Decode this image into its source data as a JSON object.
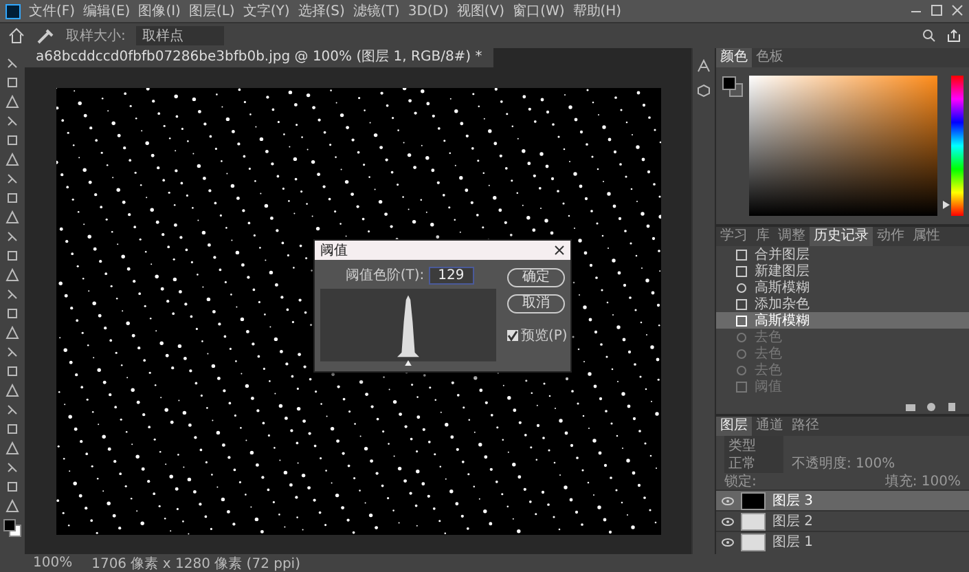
{
  "menu": [
    "文件(F)",
    "编辑(E)",
    "图像(I)",
    "图层(L)",
    "文字(Y)",
    "选择(S)",
    "滤镜(T)",
    "3D(D)",
    "视图(V)",
    "窗口(W)",
    "帮助(H)"
  ],
  "options_bar": {
    "sample_size_label": "取样大小:",
    "sample_size_value": "取样点"
  },
  "document_tab": {
    "title": "a68bcddccd0fbfb07286be3bfb0b.jpg @ 100% (图层 1, RGB/8#) *"
  },
  "threshold_dialog": {
    "title": "阈值",
    "level_label": "阈值色阶(T):",
    "level_value": "129",
    "ok": "确定",
    "cancel": "取消",
    "preview_label": "预览(P)",
    "preview_checked": true
  },
  "color_panel": {
    "hue_slider": {
      "level": 0.08
    },
    "tabs": [
      {
        "label": "颜色",
        "selected": true
      },
      {
        "label": "色板",
        "selected": false
      }
    ]
  },
  "history_panel": {
    "tabs": [
      {
        "label": "学习",
        "selected": false
      },
      {
        "label": "库",
        "selected": false
      },
      {
        "label": "调整",
        "selected": false
      },
      {
        "label": "历史记录",
        "selected": true
      },
      {
        "label": "动作",
        "selected": false
      },
      {
        "label": "属性",
        "selected": false
      }
    ],
    "items": [
      {
        "label": "合并图层",
        "kind": "doc",
        "selected": false,
        "disabled": false
      },
      {
        "label": "新建图层",
        "kind": "doc",
        "selected": false,
        "disabled": false
      },
      {
        "label": "高斯模糊",
        "kind": "filter",
        "selected": false,
        "disabled": false
      },
      {
        "label": "添加杂色",
        "kind": "doc",
        "selected": false,
        "disabled": false
      },
      {
        "label": "高斯模糊",
        "kind": "doc",
        "selected": true,
        "disabled": false
      },
      {
        "label": "去色",
        "kind": "filter",
        "selected": false,
        "disabled": true
      },
      {
        "label": "去色",
        "kind": "filter",
        "selected": false,
        "disabled": true
      },
      {
        "label": "去色",
        "kind": "filter",
        "selected": false,
        "disabled": true
      },
      {
        "label": "阈值",
        "kind": "doc",
        "selected": false,
        "disabled": true
      }
    ]
  },
  "layers_panel": {
    "tabs": [
      {
        "label": "图层",
        "selected": true
      },
      {
        "label": "通道",
        "selected": false
      },
      {
        "label": "路径",
        "selected": false
      }
    ],
    "filter_placeholder": "类型",
    "blend_mode": "正常",
    "opacity": "不透明度: 100%",
    "lock_label": "锁定:",
    "fill": "填充: 100%",
    "layers": [
      {
        "name": "图层 3",
        "selected": true,
        "kind": "dark"
      },
      {
        "name": "图层 2",
        "selected": false,
        "kind": "light"
      },
      {
        "name": "图层 1",
        "selected": false,
        "kind": "light"
      }
    ]
  },
  "status_bar": {
    "zoom": "100%",
    "info": "1706 像素 x 1280 像素 (72 ppi)"
  }
}
